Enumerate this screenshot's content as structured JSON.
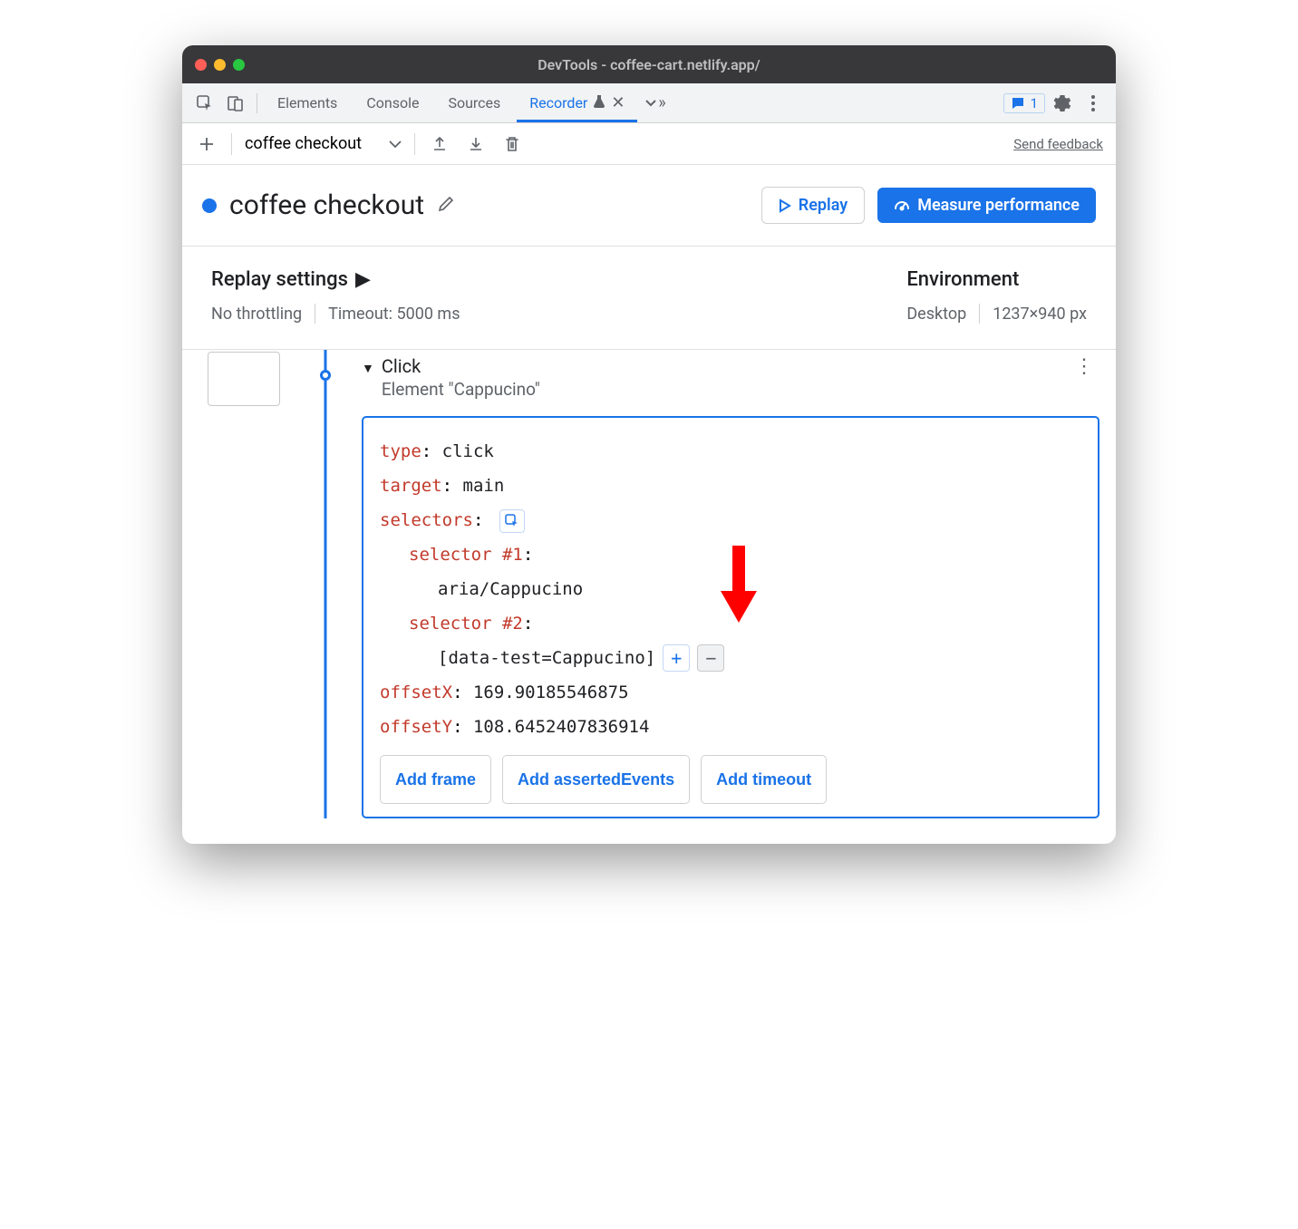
{
  "window": {
    "title": "DevTools - coffee-cart.netlify.app/"
  },
  "tabs": {
    "elements": "Elements",
    "console": "Console",
    "sources": "Sources",
    "recorder": "Recorder",
    "issues_count": "1"
  },
  "toolbar": {
    "recording_name": "coffee checkout",
    "send_feedback": "Send feedback"
  },
  "heading": {
    "title": "coffee checkout",
    "replay_label": "Replay",
    "measure_label": "Measure performance"
  },
  "settings": {
    "replay_title": "Replay settings",
    "throttling": "No throttling",
    "timeout": "Timeout: 5000 ms",
    "env_title": "Environment",
    "device": "Desktop",
    "viewport": "1237×940 px"
  },
  "step": {
    "title": "Click",
    "subtitle": "Element \"Cappucino\"",
    "fields": {
      "type_key": "type",
      "type_val": "click",
      "target_key": "target",
      "target_val": "main",
      "selectors_key": "selectors",
      "sel1_key": "selector #1",
      "sel1_val": "aria/Cappucino",
      "sel2_key": "selector #2",
      "sel2_val": "[data-test=Cappucino]",
      "offx_key": "offsetX",
      "offx_val": "169.90185546875",
      "offy_key": "offsetY",
      "offy_val": "108.6452407836914"
    },
    "add_frame": "Add frame",
    "add_asserted": "Add assertedEvents",
    "add_timeout": "Add timeout"
  }
}
